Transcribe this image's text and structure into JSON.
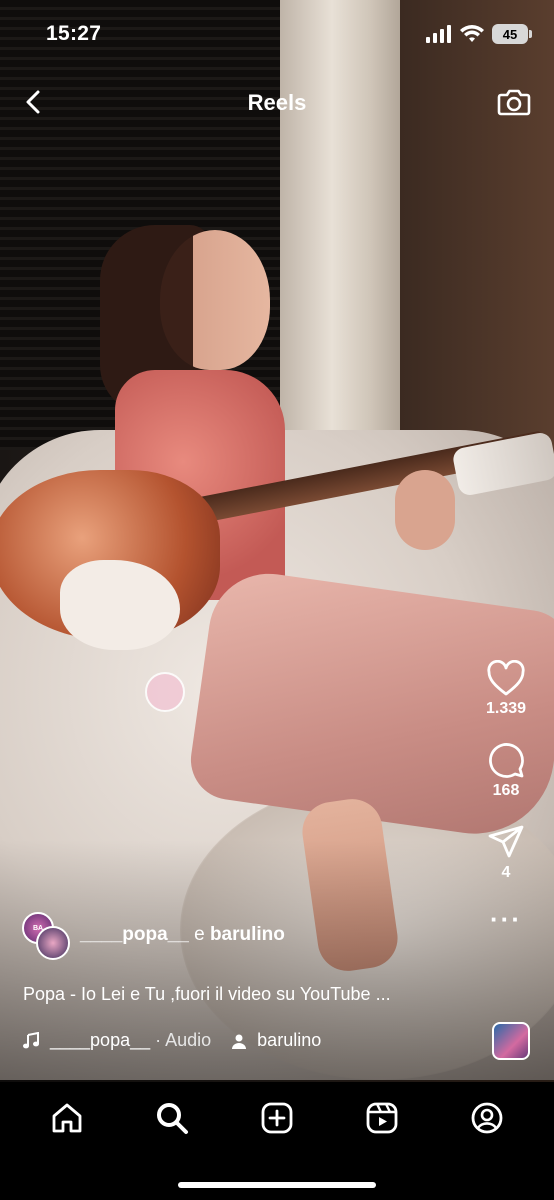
{
  "status_bar": {
    "time": "15:27",
    "battery": "45"
  },
  "header": {
    "title": "Reels"
  },
  "video": {
    "description": ""
  },
  "actions": {
    "likes": "1.339",
    "comments": "168",
    "shares": "4"
  },
  "post": {
    "creator": "____popa__",
    "conjunction": "e",
    "collaborator": "barulino",
    "caption": "Popa - Io Lei e Tu ,fuori il video su YouTube ...",
    "audio_author": "____popa__",
    "audio_label": "· Audio",
    "tagged_user": "barulino"
  },
  "icons": {
    "back": "chevron-left-icon",
    "camera": "camera-icon",
    "like": "heart-icon",
    "comment": "comment-icon",
    "share": "send-icon",
    "more": "more-icon",
    "music": "music-note-icon",
    "person": "person-icon",
    "nav": [
      "home-icon",
      "search-icon",
      "create-icon",
      "reels-icon",
      "profile-icon"
    ]
  }
}
